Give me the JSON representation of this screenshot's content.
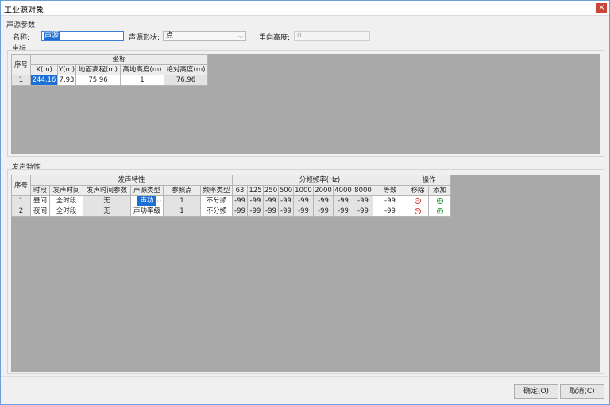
{
  "window": {
    "title": "工业源对象",
    "close_label": "×"
  },
  "params": {
    "section_title": "声源参数",
    "name_label": "名称:",
    "name_value": "声源",
    "shape_label": "声源形状:",
    "shape_value": "点",
    "height_label": "垂向高度:",
    "height_value": "0"
  },
  "coords": {
    "section_title": "坐标",
    "headers": {
      "index": "序号",
      "group": "坐标",
      "x": "X(m)",
      "y": "Y(m)",
      "ground": "地面高程(m)",
      "rel_height": "高地高度(m)",
      "abs_height": "绝对高度(m)"
    },
    "rows": [
      {
        "index": "1",
        "x": "244.16",
        "y": "7.93",
        "ground": "75.96",
        "rel_height": "1",
        "abs_height": "76.96"
      }
    ]
  },
  "emission": {
    "section_title": "发声特性",
    "headers": {
      "index": "序号",
      "group_char": "发声特性",
      "group_freq": "分频频率(Hz)",
      "group_ops": "操作",
      "period": "时段",
      "time": "发声时间",
      "time_param": "发声时间参数",
      "source_type": "声源类型",
      "ref_point": "参照点",
      "freq_type": "频率类型",
      "f63": "63",
      "f125": "125",
      "f250": "250",
      "f500": "500",
      "f1000": "1000",
      "f2000": "2000",
      "f4000": "4000",
      "f8000": "8000",
      "equiv": "等效",
      "remove": "移除",
      "add": "添加"
    },
    "rows": [
      {
        "index": "1",
        "period": "昼间",
        "time": "全时段",
        "time_param": "无",
        "source_type": "声功",
        "ref_point": "1",
        "freq_type": "不分频",
        "f63": "-99",
        "f125": "-99",
        "f250": "-99",
        "f500": "-99",
        "f1000": "-99",
        "f2000": "-99",
        "f4000": "-99",
        "f8000": "-99",
        "equiv": "-99",
        "remove_icon": "remove-icon",
        "add_icon": "add-icon"
      },
      {
        "index": "2",
        "period": "夜间",
        "time": "全时段",
        "time_param": "无",
        "source_type": "声功率级",
        "ref_point": "1",
        "freq_type": "不分频",
        "f63": "-99",
        "f125": "-99",
        "f250": "-99",
        "f500": "-99",
        "f1000": "-99",
        "f2000": "-99",
        "f4000": "-99",
        "f8000": "-99",
        "equiv": "-99",
        "remove_icon": "remove-icon",
        "add_icon": "add-icon"
      }
    ]
  },
  "icons": {
    "remove_glyph": "−",
    "add_glyph": "+",
    "dropdown_glyph": "⌵"
  },
  "buttons": {
    "ok": "确定(O)",
    "cancel": "取消(C)"
  }
}
